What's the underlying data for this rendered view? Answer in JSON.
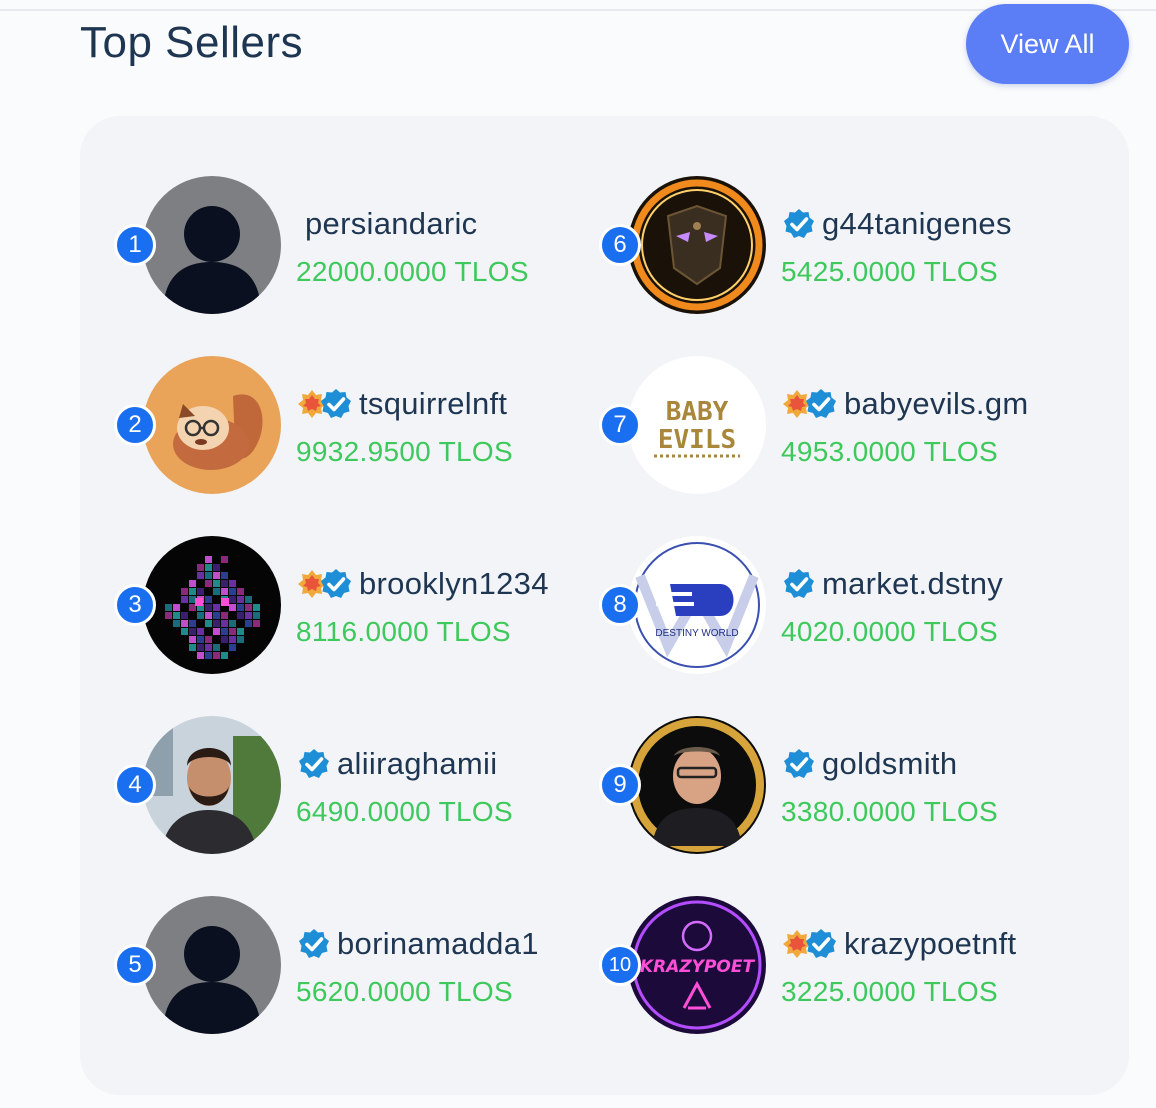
{
  "header": {
    "title": "Top Sellers",
    "view_all_label": "View All"
  },
  "sellers": [
    {
      "rank": "1",
      "name": "persiandaric",
      "amount": "22000.0000 TLOS",
      "badges": [],
      "avatar": "default-avatar"
    },
    {
      "rank": "2",
      "name": "tsquirrelnft",
      "amount": "9932.9500 TLOS",
      "badges": [
        "star-badge-icon",
        "verified-icon"
      ],
      "avatar": "squirrel-avatar"
    },
    {
      "rank": "3",
      "name": "brooklyn1234",
      "amount": "8116.0000 TLOS",
      "badges": [
        "star-badge-icon",
        "verified-icon"
      ],
      "avatar": "pixel-avatar"
    },
    {
      "rank": "4",
      "name": "aliiraghamii",
      "amount": "6490.0000 TLOS",
      "badges": [
        "verified-icon"
      ],
      "avatar": "photo-avatar"
    },
    {
      "rank": "5",
      "name": "borinamadda1",
      "amount": "5620.0000 TLOS",
      "badges": [
        "verified-icon"
      ],
      "avatar": "default-avatar"
    },
    {
      "rank": "6",
      "name": "g44tanigenes",
      "amount": "5425.0000 TLOS",
      "badges": [
        "verified-icon"
      ],
      "avatar": "mask-avatar"
    },
    {
      "rank": "7",
      "name": "babyevils.gm",
      "amount": "4953.0000 TLOS",
      "badges": [
        "star-badge-icon",
        "verified-icon"
      ],
      "avatar": "babyevils-logo",
      "logo_text": [
        "BABY",
        "EVILS"
      ]
    },
    {
      "rank": "8",
      "name": "market.dstny",
      "amount": "4020.0000 TLOS",
      "badges": [
        "verified-icon"
      ],
      "avatar": "destiny-world-logo",
      "logo_text": [
        "DESTINY WORLD"
      ]
    },
    {
      "rank": "9",
      "name": "goldsmith",
      "amount": "3380.0000 TLOS",
      "badges": [
        "verified-icon"
      ],
      "avatar": "gold-ring-photo-avatar"
    },
    {
      "rank": "10",
      "name": "krazypoetnft",
      "amount": "3225.0000 TLOS",
      "badges": [
        "star-badge-icon",
        "verified-icon"
      ],
      "avatar": "krazypoet-logo",
      "logo_text": [
        "KRAZYPOET"
      ]
    }
  ],
  "colors": {
    "title": "#1e3652",
    "button": "#5b7df5",
    "amount": "#3ec95c",
    "rank_badge": "#1a6ff0",
    "card": "#f2f4f7"
  }
}
